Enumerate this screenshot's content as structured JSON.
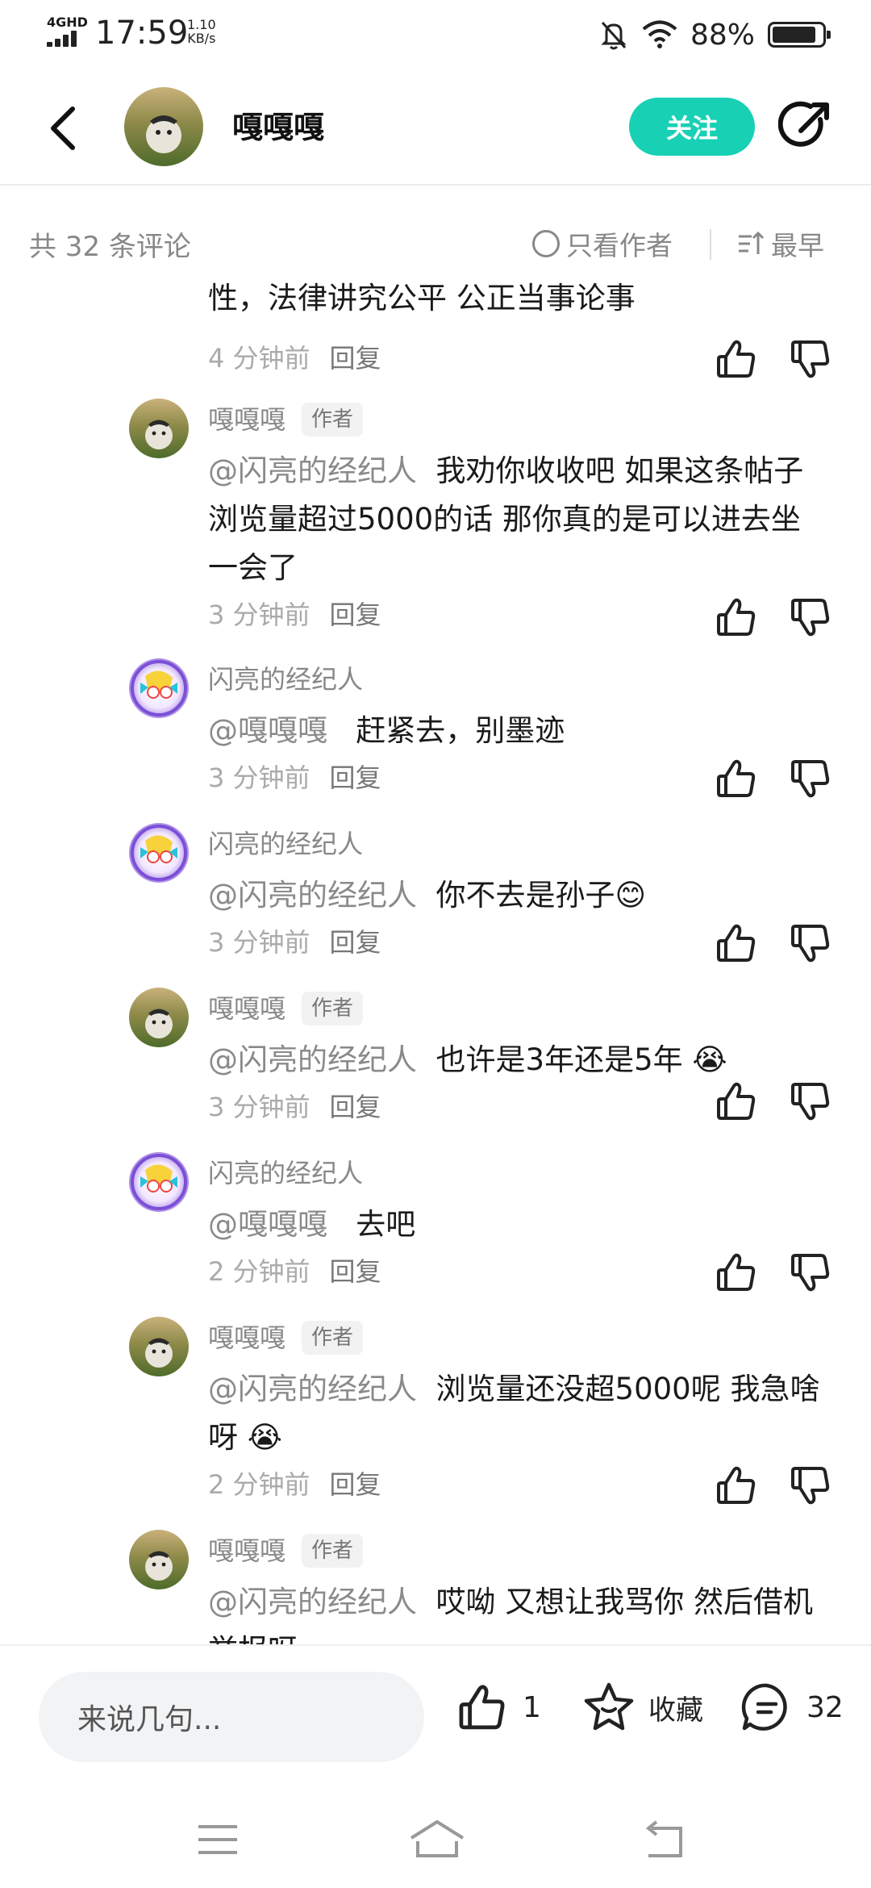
{
  "status_bar": {
    "network": "4GHD",
    "time": "17:59",
    "speed_value": "1.10",
    "speed_unit": "KB/s",
    "battery_text": "88%",
    "battery_level": 0.88
  },
  "header": {
    "title": "嘎嘎嘎",
    "follow_label": "关注"
  },
  "comments_header": {
    "count_label": "共 32 条评论",
    "only_author_label": "只看作者",
    "sort_label": "最早"
  },
  "comments": [
    {
      "name": "",
      "tag": "",
      "text": "性，法律讲究公平 公正当事论事",
      "mention": "",
      "time": "4 分钟前",
      "reply": "回复"
    },
    {
      "name": "嘎嘎嘎",
      "tag": "作者",
      "mention": "@闪亮的经纪人",
      "text": "我劝你收收吧  如果这条帖子浏览量超过5000的话 那你真的是可以进去坐一会了",
      "time": "3 分钟前",
      "reply": "回复"
    },
    {
      "name": "闪亮的经纪人",
      "tag": "",
      "mention": "@嘎嘎嘎",
      "text": "赶紧去，别墨迹",
      "time": "3 分钟前",
      "reply": "回复"
    },
    {
      "name": "闪亮的经纪人",
      "tag": "",
      "mention": "@闪亮的经纪人",
      "text": "你不去是孙子😊",
      "time": "3 分钟前",
      "reply": "回复"
    },
    {
      "name": "嘎嘎嘎",
      "tag": "作者",
      "mention": "@闪亮的经纪人",
      "text": "也许是3年还是5年 😭",
      "time": "3 分钟前",
      "reply": "回复"
    },
    {
      "name": "闪亮的经纪人",
      "tag": "",
      "mention": "@嘎嘎嘎",
      "text": "去吧",
      "time": "2 分钟前",
      "reply": "回复"
    },
    {
      "name": "嘎嘎嘎",
      "tag": "作者",
      "mention": "@闪亮的经纪人",
      "text": "浏览量还没超5000呢 我急啥呀 😭",
      "time": "2 分钟前",
      "reply": "回复"
    },
    {
      "name": "嘎嘎嘎",
      "tag": "作者",
      "mention": "@闪亮的经纪人",
      "text": "哎呦 又想让我骂你 然后借机举报呀",
      "time": "",
      "reply": ""
    }
  ],
  "bottom_bar": {
    "input_placeholder": "来说几句...",
    "like_count": "1",
    "favorite_label": "收藏",
    "comment_count": "32"
  },
  "colors": {
    "accent": "#18d1b5",
    "secondary_text": "#888888"
  }
}
